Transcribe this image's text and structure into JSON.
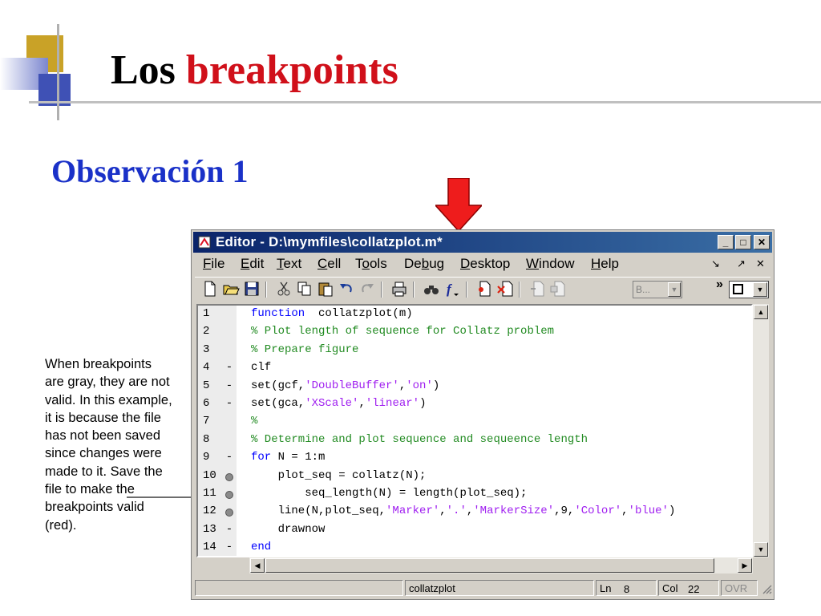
{
  "slide": {
    "title_part1": "Los",
    "title_part2": "breakpoints",
    "subtitle": "Observación 1",
    "note": "When breakpoints are gray, they are not valid. In this example, it is because the file has not been saved since changes were made to it. Save the file to make the breakpoints valid (red)."
  },
  "window": {
    "title": "Editor - D:\\mymfiles\\collatzplot.m*"
  },
  "menu": [
    {
      "key": "F",
      "rest": "ile",
      "pre": ""
    },
    {
      "key": "E",
      "rest": "dit",
      "pre": ""
    },
    {
      "key": "T",
      "rest": "ext",
      "pre": ""
    },
    {
      "key": "C",
      "rest": "ell",
      "pre": ""
    },
    {
      "key": "o",
      "rest": "ols",
      "pre": "T"
    },
    {
      "key": "b",
      "rest": "ug",
      "pre": "De"
    },
    {
      "key": "D",
      "rest": "esktop",
      "pre": ""
    },
    {
      "key": "W",
      "rest": "indow",
      "pre": ""
    },
    {
      "key": "H",
      "rest": "elp",
      "pre": ""
    }
  ],
  "toolbar": {
    "stack_label": "B...",
    "overflow": "»"
  },
  "code": [
    {
      "n": "1",
      "bp": "",
      "parts": [
        [
          "kw",
          "function"
        ],
        [
          "",
          "  collatzplot(m)"
        ]
      ]
    },
    {
      "n": "2",
      "bp": "",
      "parts": [
        [
          "cm",
          "% Plot length of sequence for Collatz problem"
        ]
      ]
    },
    {
      "n": "3",
      "bp": "",
      "parts": [
        [
          "cm",
          "% Prepare figure"
        ]
      ]
    },
    {
      "n": "4",
      "bp": "-",
      "parts": [
        [
          "",
          "clf"
        ]
      ]
    },
    {
      "n": "5",
      "bp": "-",
      "parts": [
        [
          "",
          "set(gcf,"
        ],
        [
          "st",
          "'DoubleBuffer'"
        ],
        [
          "",
          ","
        ],
        [
          "st",
          "'on'"
        ],
        [
          "",
          ")"
        ]
      ]
    },
    {
      "n": "6",
      "bp": "-",
      "parts": [
        [
          "",
          "set(gca,"
        ],
        [
          "st",
          "'XScale'"
        ],
        [
          "",
          ","
        ],
        [
          "st",
          "'linear'"
        ],
        [
          "",
          ")"
        ]
      ]
    },
    {
      "n": "7",
      "bp": "",
      "parts": [
        [
          "cm",
          "%"
        ]
      ]
    },
    {
      "n": "8",
      "bp": "",
      "parts": [
        [
          "cm",
          "% Determine and plot sequence and sequeence length"
        ]
      ]
    },
    {
      "n": "9",
      "bp": "-",
      "parts": [
        [
          "kw",
          "for"
        ],
        [
          "",
          " N = 1:m"
        ]
      ]
    },
    {
      "n": "10",
      "bp": "dot",
      "parts": [
        [
          "",
          "    plot_seq = collatz(N);"
        ]
      ]
    },
    {
      "n": "11",
      "bp": "dot",
      "parts": [
        [
          "",
          "        seq_length(N) = length(plot_seq);"
        ]
      ]
    },
    {
      "n": "12",
      "bp": "dot",
      "parts": [
        [
          "",
          "    line(N,plot_seq,"
        ],
        [
          "st",
          "'Marker'"
        ],
        [
          "",
          ","
        ],
        [
          "st",
          "'.'"
        ],
        [
          "",
          ","
        ],
        [
          "st",
          "'MarkerSize'"
        ],
        [
          "",
          ",9,"
        ],
        [
          "st",
          "'Color'"
        ],
        [
          "",
          ","
        ],
        [
          "st",
          "'blue'"
        ],
        [
          "",
          ")"
        ]
      ]
    },
    {
      "n": "13",
      "bp": "-",
      "parts": [
        [
          "",
          "    drawnow"
        ]
      ]
    },
    {
      "n": "14",
      "bp": "-",
      "parts": [
        [
          "kw",
          "end"
        ]
      ]
    }
  ],
  "status": {
    "file": "collatzplot",
    "ln_label": "Ln",
    "ln_value": "8",
    "col_label": "Col",
    "col_value": "22",
    "ovr": "OVR"
  }
}
